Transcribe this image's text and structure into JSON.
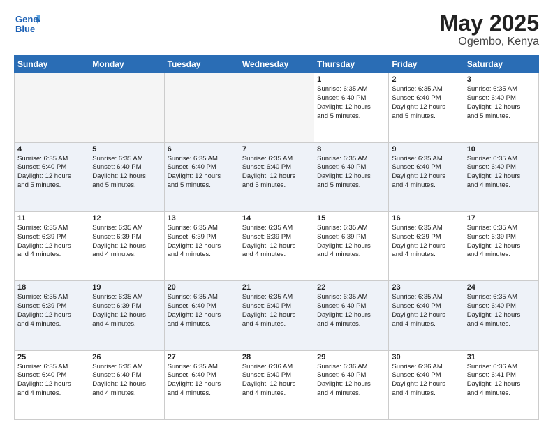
{
  "logo": {
    "line1": "General",
    "line2": "Blue"
  },
  "title": {
    "month": "May 2025",
    "location": "Ogembo, Kenya"
  },
  "weekdays": [
    "Sunday",
    "Monday",
    "Tuesday",
    "Wednesday",
    "Thursday",
    "Friday",
    "Saturday"
  ],
  "weeks": [
    [
      {
        "day": "",
        "info": ""
      },
      {
        "day": "",
        "info": ""
      },
      {
        "day": "",
        "info": ""
      },
      {
        "day": "",
        "info": ""
      },
      {
        "day": "1",
        "info": "Sunrise: 6:35 AM\nSunset: 6:40 PM\nDaylight: 12 hours\nand 5 minutes."
      },
      {
        "day": "2",
        "info": "Sunrise: 6:35 AM\nSunset: 6:40 PM\nDaylight: 12 hours\nand 5 minutes."
      },
      {
        "day": "3",
        "info": "Sunrise: 6:35 AM\nSunset: 6:40 PM\nDaylight: 12 hours\nand 5 minutes."
      }
    ],
    [
      {
        "day": "4",
        "info": "Sunrise: 6:35 AM\nSunset: 6:40 PM\nDaylight: 12 hours\nand 5 minutes."
      },
      {
        "day": "5",
        "info": "Sunrise: 6:35 AM\nSunset: 6:40 PM\nDaylight: 12 hours\nand 5 minutes."
      },
      {
        "day": "6",
        "info": "Sunrise: 6:35 AM\nSunset: 6:40 PM\nDaylight: 12 hours\nand 5 minutes."
      },
      {
        "day": "7",
        "info": "Sunrise: 6:35 AM\nSunset: 6:40 PM\nDaylight: 12 hours\nand 5 minutes."
      },
      {
        "day": "8",
        "info": "Sunrise: 6:35 AM\nSunset: 6:40 PM\nDaylight: 12 hours\nand 5 minutes."
      },
      {
        "day": "9",
        "info": "Sunrise: 6:35 AM\nSunset: 6:40 PM\nDaylight: 12 hours\nand 4 minutes."
      },
      {
        "day": "10",
        "info": "Sunrise: 6:35 AM\nSunset: 6:40 PM\nDaylight: 12 hours\nand 4 minutes."
      }
    ],
    [
      {
        "day": "11",
        "info": "Sunrise: 6:35 AM\nSunset: 6:39 PM\nDaylight: 12 hours\nand 4 minutes."
      },
      {
        "day": "12",
        "info": "Sunrise: 6:35 AM\nSunset: 6:39 PM\nDaylight: 12 hours\nand 4 minutes."
      },
      {
        "day": "13",
        "info": "Sunrise: 6:35 AM\nSunset: 6:39 PM\nDaylight: 12 hours\nand 4 minutes."
      },
      {
        "day": "14",
        "info": "Sunrise: 6:35 AM\nSunset: 6:39 PM\nDaylight: 12 hours\nand 4 minutes."
      },
      {
        "day": "15",
        "info": "Sunrise: 6:35 AM\nSunset: 6:39 PM\nDaylight: 12 hours\nand 4 minutes."
      },
      {
        "day": "16",
        "info": "Sunrise: 6:35 AM\nSunset: 6:39 PM\nDaylight: 12 hours\nand 4 minutes."
      },
      {
        "day": "17",
        "info": "Sunrise: 6:35 AM\nSunset: 6:39 PM\nDaylight: 12 hours\nand 4 minutes."
      }
    ],
    [
      {
        "day": "18",
        "info": "Sunrise: 6:35 AM\nSunset: 6:39 PM\nDaylight: 12 hours\nand 4 minutes."
      },
      {
        "day": "19",
        "info": "Sunrise: 6:35 AM\nSunset: 6:39 PM\nDaylight: 12 hours\nand 4 minutes."
      },
      {
        "day": "20",
        "info": "Sunrise: 6:35 AM\nSunset: 6:40 PM\nDaylight: 12 hours\nand 4 minutes."
      },
      {
        "day": "21",
        "info": "Sunrise: 6:35 AM\nSunset: 6:40 PM\nDaylight: 12 hours\nand 4 minutes."
      },
      {
        "day": "22",
        "info": "Sunrise: 6:35 AM\nSunset: 6:40 PM\nDaylight: 12 hours\nand 4 minutes."
      },
      {
        "day": "23",
        "info": "Sunrise: 6:35 AM\nSunset: 6:40 PM\nDaylight: 12 hours\nand 4 minutes."
      },
      {
        "day": "24",
        "info": "Sunrise: 6:35 AM\nSunset: 6:40 PM\nDaylight: 12 hours\nand 4 minutes."
      }
    ],
    [
      {
        "day": "25",
        "info": "Sunrise: 6:35 AM\nSunset: 6:40 PM\nDaylight: 12 hours\nand 4 minutes."
      },
      {
        "day": "26",
        "info": "Sunrise: 6:35 AM\nSunset: 6:40 PM\nDaylight: 12 hours\nand 4 minutes."
      },
      {
        "day": "27",
        "info": "Sunrise: 6:35 AM\nSunset: 6:40 PM\nDaylight: 12 hours\nand 4 minutes."
      },
      {
        "day": "28",
        "info": "Sunrise: 6:36 AM\nSunset: 6:40 PM\nDaylight: 12 hours\nand 4 minutes."
      },
      {
        "day": "29",
        "info": "Sunrise: 6:36 AM\nSunset: 6:40 PM\nDaylight: 12 hours\nand 4 minutes."
      },
      {
        "day": "30",
        "info": "Sunrise: 6:36 AM\nSunset: 6:40 PM\nDaylight: 12 hours\nand 4 minutes."
      },
      {
        "day": "31",
        "info": "Sunrise: 6:36 AM\nSunset: 6:41 PM\nDaylight: 12 hours\nand 4 minutes."
      }
    ]
  ]
}
